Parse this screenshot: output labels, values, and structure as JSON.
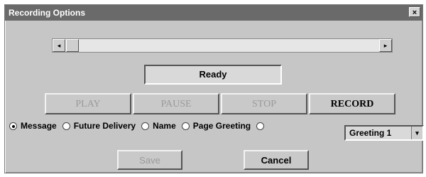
{
  "window": {
    "title": "Recording Options",
    "close_label": "×"
  },
  "scrollbar": {
    "left_arrow": "◂",
    "right_arrow": "▸"
  },
  "status": {
    "text": "Ready"
  },
  "controls": {
    "play": "PLAY",
    "pause": "PAUSE",
    "stop": "STOP",
    "record": "RECORD"
  },
  "options": [
    {
      "label": "Message",
      "checked": true
    },
    {
      "label": "Future Delivery",
      "checked": false
    },
    {
      "label": "Name",
      "checked": false
    },
    {
      "label": "Page Greeting",
      "checked": false
    },
    {
      "label": "",
      "checked": false
    }
  ],
  "greeting_select": {
    "value": "Greeting 1",
    "arrow": "▾"
  },
  "footer": {
    "save": "Save",
    "cancel": "Cancel"
  }
}
